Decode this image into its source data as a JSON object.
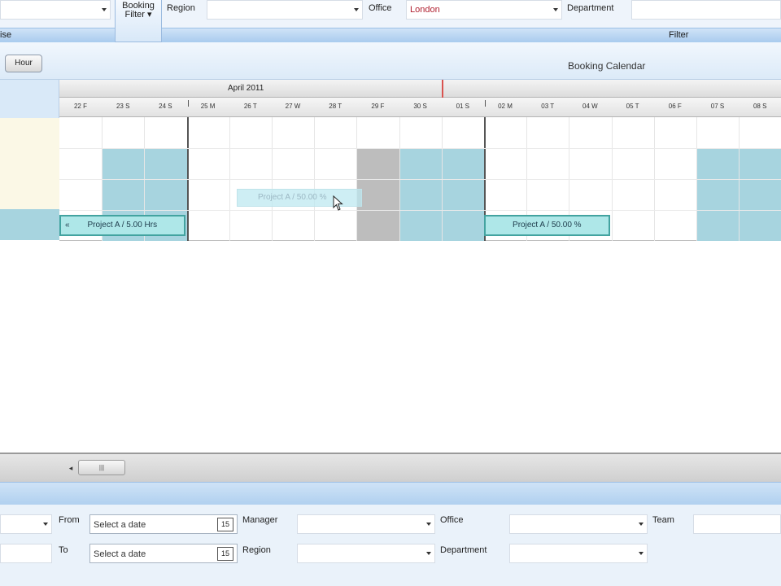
{
  "top_filters": {
    "booking_filter_label": "Booking Filter ▾",
    "region_label": "Region",
    "office_label": "Office",
    "office_value": "London",
    "department_label": "Department"
  },
  "strip": {
    "left_text": "ise",
    "filter_label": "Filter"
  },
  "toolbar": {
    "hour_button": "Hour",
    "title": "Booking Calendar"
  },
  "calendar": {
    "month": "April 2011",
    "days": [
      "22 F",
      "23 S",
      "24 S",
      "25 M",
      "26 T",
      "27 W",
      "28 T",
      "29 F",
      "30 S",
      "01 S",
      "02 M",
      "03 T",
      "04 W",
      "05 T",
      "06 F",
      "07 S",
      "08 S"
    ],
    "bookings": [
      {
        "label": "Project A / 5.00 Hrs",
        "prefix": "«"
      },
      {
        "label": "Project A / 50.00 %"
      }
    ],
    "drag_preview": "Project A / 50.00 %"
  },
  "scrollbar": {
    "left_arrow": "◂",
    "thumb_grip": "|||"
  },
  "bottom_filters": {
    "from_label": "From",
    "to_label": "To",
    "from_placeholder": "Select a date",
    "to_placeholder": "Select a date",
    "calendar_icon_text": "15",
    "manager_label": "Manager",
    "region_label": "Region",
    "office_label": "Office",
    "department_label": "Department",
    "team_label": "Team"
  },
  "colors": {
    "weekend_fill": "#a7d4df",
    "holiday_fill": "#bdbdbd",
    "booking_fill": "#aee7e8",
    "accent_today": "#d9534f"
  }
}
